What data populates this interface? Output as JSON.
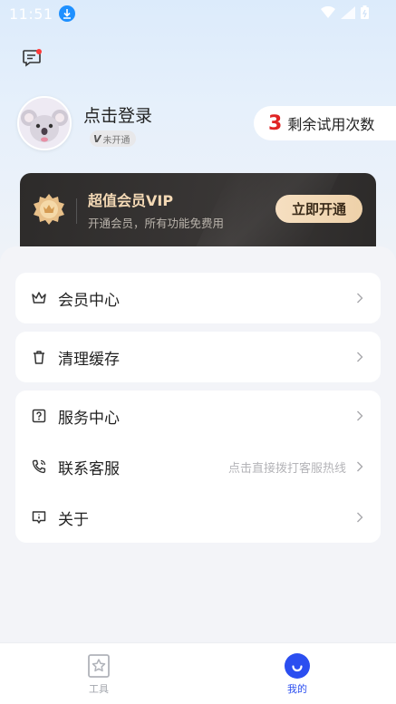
{
  "status_bar": {
    "time": "11:51"
  },
  "profile": {
    "login_text": "点击登录",
    "vip_status": "未开通",
    "vip_mark": "V",
    "trial_count": "3",
    "trial_label": "剩余试用次数"
  },
  "vip_card": {
    "title": "超值会员VIP",
    "subtitle": "开通会员，所有功能免费用",
    "button": "立即开通"
  },
  "menu": {
    "member_center": "会员中心",
    "clear_cache": "清理缓存",
    "service_center": "服务中心",
    "contact_service": "联系客服",
    "contact_hint": "点击直接拨打客服热线",
    "about": "关于"
  },
  "tabs": [
    {
      "label": "工具",
      "icon": "tool-icon"
    },
    {
      "label": "我的",
      "icon": "mine-icon"
    }
  ],
  "colors": {
    "accent": "#2b4ef0",
    "trial_number": "#e02424",
    "vip_gold": "#f4d9b5"
  }
}
